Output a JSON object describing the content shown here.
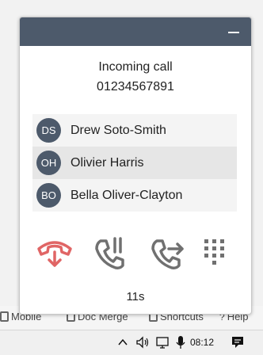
{
  "background_toolbar": {
    "items": [
      "Mobile",
      "Doc Merge",
      "Shortcuts",
      "Help"
    ]
  },
  "call": {
    "title": "Incoming call",
    "number": "01234567891",
    "contacts": [
      {
        "initials": "DS",
        "name": "Drew Soto-Smith"
      },
      {
        "initials": "OH",
        "name": "Olivier Harris"
      },
      {
        "initials": "BO",
        "name": "Bella Oliver-Clayton"
      }
    ],
    "timer": "11s",
    "actions": [
      "hang-up",
      "hold",
      "transfer",
      "keypad"
    ]
  },
  "taskbar": {
    "clock": "08:12",
    "icons": [
      "chevron-up-icon",
      "speaker-icon",
      "network-icon",
      "microphone-icon",
      "notification-icon"
    ]
  },
  "colors": {
    "header": "#4d5a6b",
    "hangup": "#e06565",
    "action_gray": "#707070"
  }
}
